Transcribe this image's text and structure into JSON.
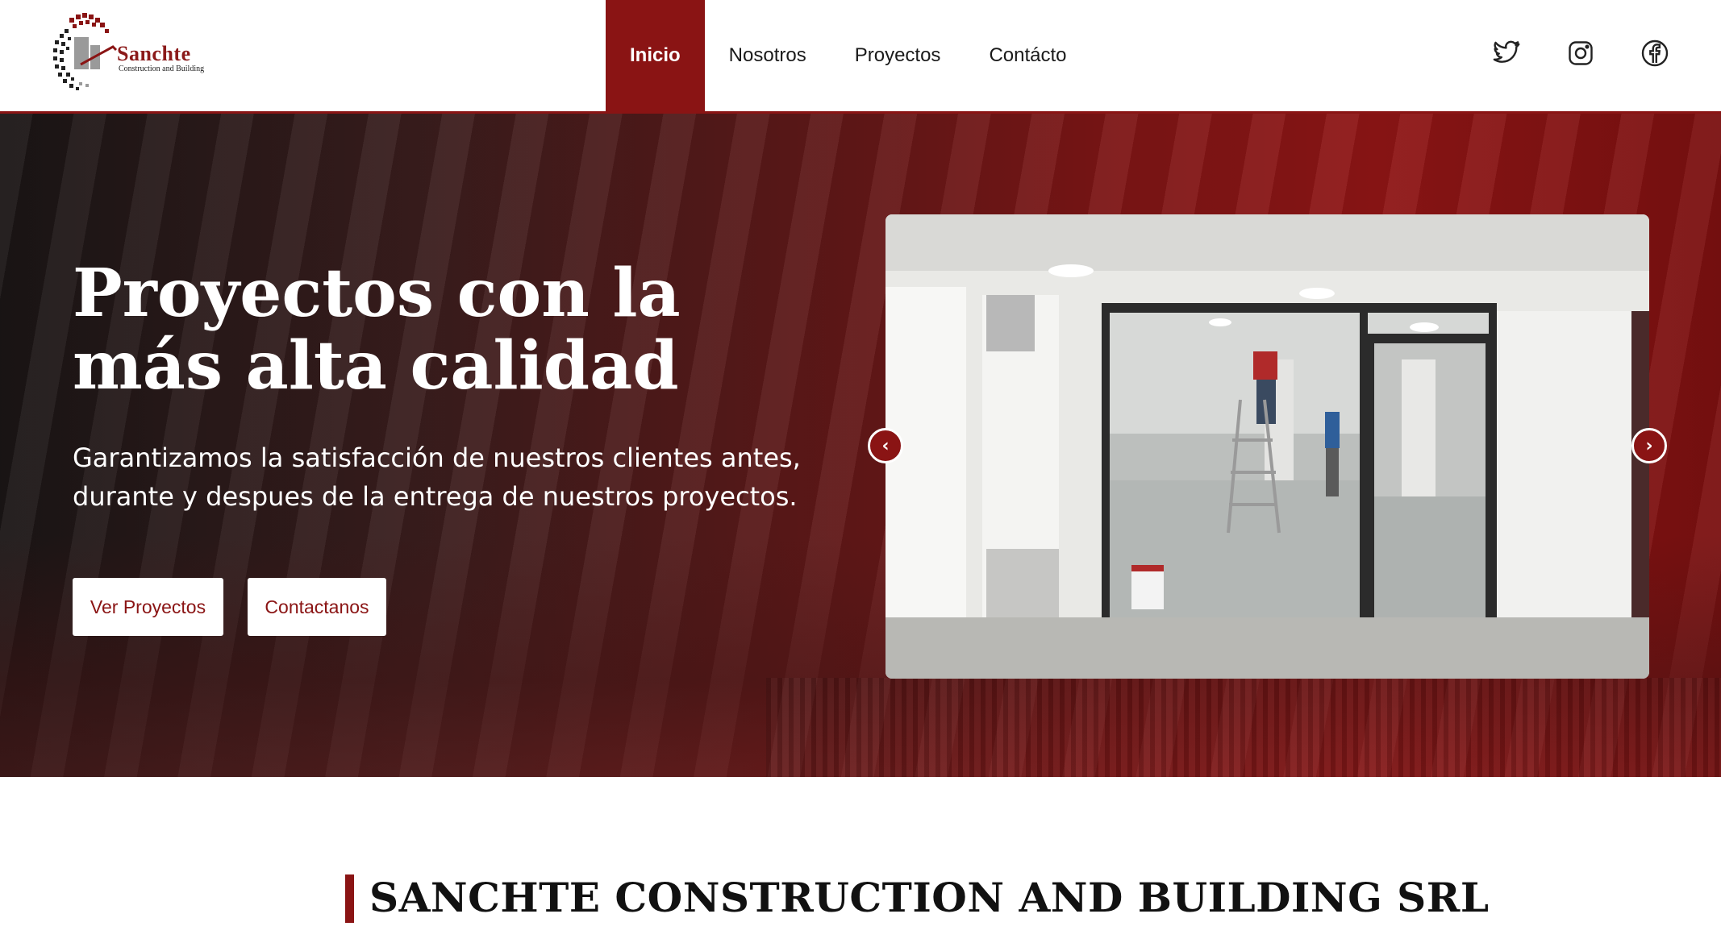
{
  "brand": {
    "name": "Sanchte",
    "tagline": "Construction and Building",
    "color_primary": "#8a1414"
  },
  "nav": {
    "items": [
      {
        "label": "Inicio",
        "active": true
      },
      {
        "label": "Nosotros",
        "active": false
      },
      {
        "label": "Proyectos",
        "active": false
      },
      {
        "label": "Contácto",
        "active": false
      }
    ]
  },
  "socials": [
    {
      "icon": "twitter-icon"
    },
    {
      "icon": "instagram-icon"
    },
    {
      "icon": "facebook-icon"
    }
  ],
  "hero": {
    "title": "Proyectos con la más alta calidad",
    "subtitle": "Garantizamos la satisfacción de nuestros clientes antes, durante y despues de la entrega de nuestros proyectos.",
    "primary_button": "Ver Proyectos",
    "secondary_button": "Contactanos",
    "carousel": {
      "prev_arrow": "‹",
      "next_arrow": "›"
    }
  },
  "section": {
    "title": "SANCHTE CONSTRUCTION AND BUILDING SRL"
  }
}
